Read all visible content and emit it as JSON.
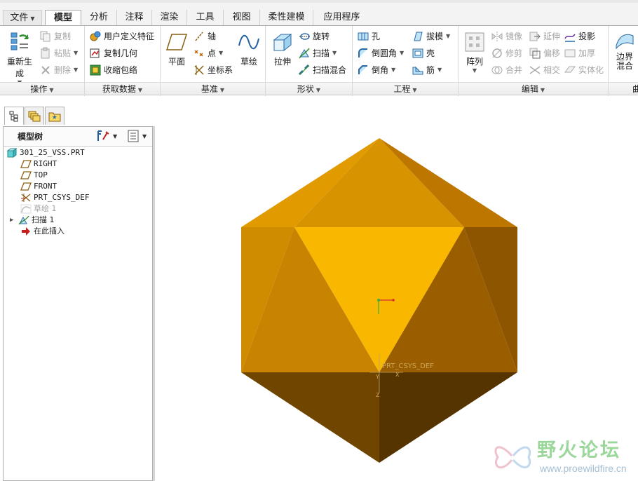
{
  "tabs": [
    {
      "label": "文件",
      "has_caret": true
    },
    {
      "label": "模型",
      "active": true
    },
    {
      "label": "分析"
    },
    {
      "label": "注释"
    },
    {
      "label": "渲染"
    },
    {
      "label": "工具"
    },
    {
      "label": "视图"
    },
    {
      "label": "柔性建模"
    },
    {
      "label": "应用程序"
    }
  ],
  "ribbon": {
    "operations": {
      "label": "操作",
      "regenerate": "重新生成",
      "copy": "复制",
      "paste": "粘贴",
      "delete": "删除"
    },
    "get_data": {
      "label": "获取数据",
      "udf": "用户定义特征",
      "copy_geometry": "复制几何",
      "shrinkwrap": "收缩包络"
    },
    "datum": {
      "label": "基准",
      "plane": "平面",
      "axis": "轴",
      "point": "点",
      "csys": "坐标系",
      "sketch": "草绘"
    },
    "shapes": {
      "label": "形状",
      "extrude": "拉伸",
      "revolve": "旋转",
      "sweep": "扫描",
      "swept_blend": "扫描混合"
    },
    "engineering": {
      "label": "工程",
      "hole": "孔",
      "round": "倒圆角",
      "chamfer": "倒角",
      "draft": "拔模",
      "shell": "壳",
      "rib": "筋"
    },
    "editing": {
      "label": "编辑",
      "pattern": "阵列",
      "mirror": "镜像",
      "extend": "延伸",
      "project": "投影",
      "trim": "修剪",
      "offset": "偏移",
      "thicken": "加厚",
      "merge": "合并",
      "intersect": "相交",
      "solidify": "实体化"
    },
    "surfaces": {
      "boundary_blend": "边界混合",
      "partial_label": "曲"
    }
  },
  "model_tree": {
    "title": "模型树",
    "items": [
      {
        "label": "301_25_VSS.PRT",
        "icon": "part-icon"
      },
      {
        "label": "RIGHT",
        "icon": "datum-plane-icon"
      },
      {
        "label": "TOP",
        "icon": "datum-plane-icon"
      },
      {
        "label": "FRONT",
        "icon": "datum-plane-icon"
      },
      {
        "label": "PRT_CSYS_DEF",
        "icon": "csys-icon"
      },
      {
        "label": "草绘 1",
        "icon": "sketch-icon",
        "dim": true
      },
      {
        "label": "扫描 1",
        "icon": "sweep-icon",
        "expandable": true
      },
      {
        "label": "在此插入",
        "icon": "insert-arrow-icon"
      }
    ]
  },
  "viewport": {
    "csys_label": "PRT_CSYS_DEF",
    "csys_axis_x": "X",
    "csys_axis_y": "Y",
    "csys_axis_z": "Z"
  },
  "watermark": {
    "title": "野火论坛",
    "url": "www.proewildfire.cn"
  },
  "colors": {
    "face_front": "#f9b700",
    "face_top_left": "#e19a00",
    "face_top_right": "#c27a00",
    "face_left": "#d38c00",
    "face_right": "#9a5e00",
    "face_bottom": "#6d4300"
  }
}
